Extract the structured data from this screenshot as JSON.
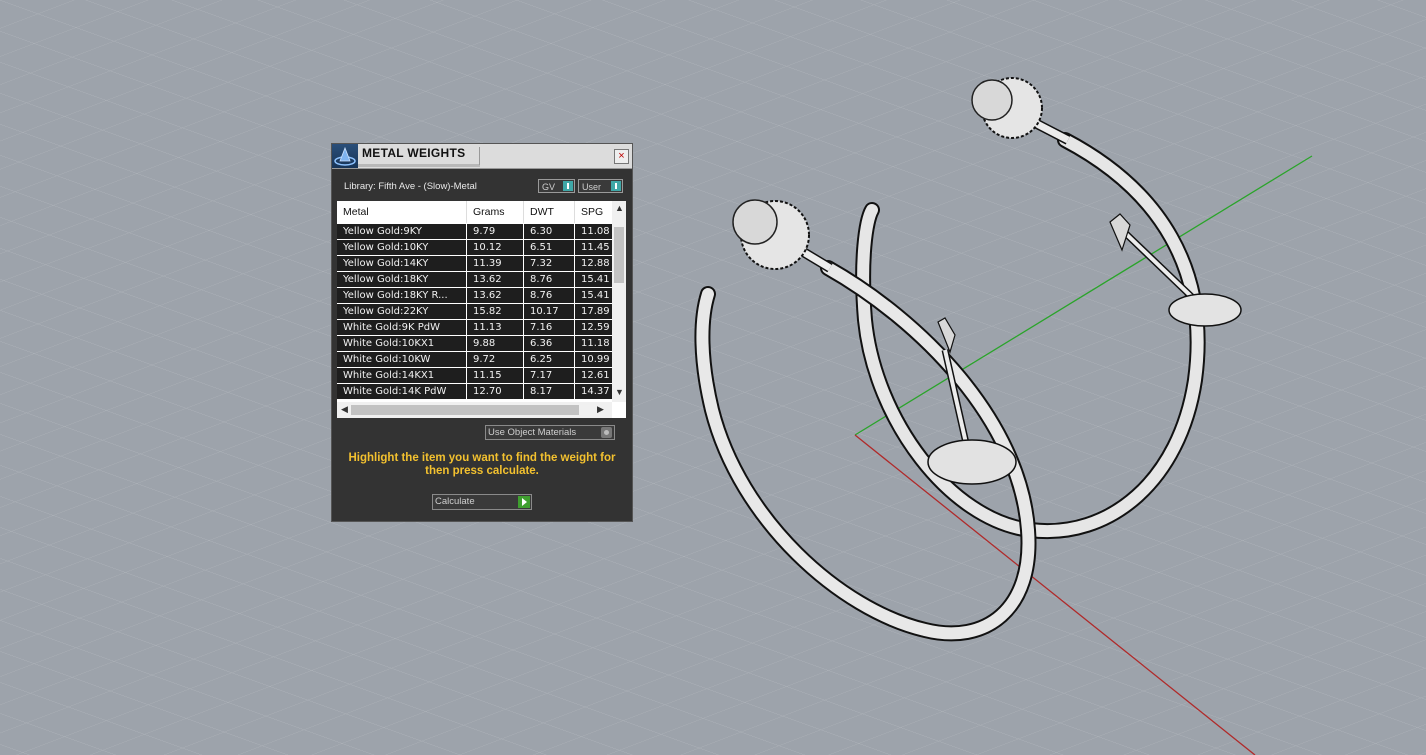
{
  "window": {
    "title": "METAL WEIGHTS",
    "library": "Library: Fifth Ave - (Slow)-Metal",
    "gv_label": "GV",
    "user_label": "User",
    "close_label": "×"
  },
  "table": {
    "columns": [
      "Metal",
      "Grams",
      "DWT",
      "SPG"
    ],
    "rows": [
      [
        "Yellow Gold:9KY",
        "9.79",
        "6.30",
        "11.08"
      ],
      [
        "Yellow Gold:10KY",
        "10.12",
        "6.51",
        "11.45"
      ],
      [
        "Yellow Gold:14KY",
        "11.39",
        "7.32",
        "12.88"
      ],
      [
        "Yellow Gold:18KY",
        "13.62",
        "8.76",
        "15.41"
      ],
      [
        "Yellow Gold:18KY R...",
        "13.62",
        "8.76",
        "15.41"
      ],
      [
        "Yellow Gold:22KY",
        "15.82",
        "10.17",
        "17.89"
      ],
      [
        "White Gold:9K PdW",
        "11.13",
        "7.16",
        "12.59"
      ],
      [
        "White Gold:10KX1",
        "9.88",
        "6.36",
        "11.18"
      ],
      [
        "White Gold:10KW",
        "9.72",
        "6.25",
        "10.99"
      ],
      [
        "White Gold:14KX1",
        "11.15",
        "7.17",
        "12.61"
      ],
      [
        "White Gold:14K PdW",
        "12.70",
        "8.17",
        "14.37"
      ]
    ]
  },
  "controls": {
    "use_object_materials": "Use Object Materials",
    "hint": "Highlight the item you want to find the weight for then press calculate.",
    "calculate": "Calculate"
  },
  "colors": {
    "panel": "#333333",
    "hint": "#f3c12f",
    "viewport": "#9da3ab"
  }
}
